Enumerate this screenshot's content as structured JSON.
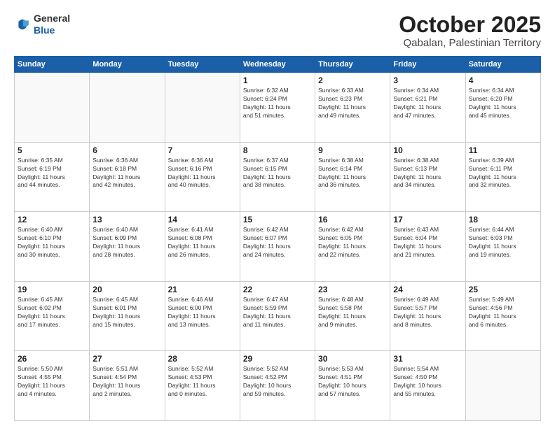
{
  "header": {
    "logo_general": "General",
    "logo_blue": "Blue",
    "month": "October 2025",
    "location": "Qabalan, Palestinian Territory"
  },
  "days_of_week": [
    "Sunday",
    "Monday",
    "Tuesday",
    "Wednesday",
    "Thursday",
    "Friday",
    "Saturday"
  ],
  "weeks": [
    [
      {
        "day": "",
        "info": ""
      },
      {
        "day": "",
        "info": ""
      },
      {
        "day": "",
        "info": ""
      },
      {
        "day": "1",
        "info": "Sunrise: 6:32 AM\nSunset: 6:24 PM\nDaylight: 11 hours\nand 51 minutes."
      },
      {
        "day": "2",
        "info": "Sunrise: 6:33 AM\nSunset: 6:23 PM\nDaylight: 11 hours\nand 49 minutes."
      },
      {
        "day": "3",
        "info": "Sunrise: 6:34 AM\nSunset: 6:21 PM\nDaylight: 11 hours\nand 47 minutes."
      },
      {
        "day": "4",
        "info": "Sunrise: 6:34 AM\nSunset: 6:20 PM\nDaylight: 11 hours\nand 45 minutes."
      }
    ],
    [
      {
        "day": "5",
        "info": "Sunrise: 6:35 AM\nSunset: 6:19 PM\nDaylight: 11 hours\nand 44 minutes."
      },
      {
        "day": "6",
        "info": "Sunrise: 6:36 AM\nSunset: 6:18 PM\nDaylight: 11 hours\nand 42 minutes."
      },
      {
        "day": "7",
        "info": "Sunrise: 6:36 AM\nSunset: 6:16 PM\nDaylight: 11 hours\nand 40 minutes."
      },
      {
        "day": "8",
        "info": "Sunrise: 6:37 AM\nSunset: 6:15 PM\nDaylight: 11 hours\nand 38 minutes."
      },
      {
        "day": "9",
        "info": "Sunrise: 6:38 AM\nSunset: 6:14 PM\nDaylight: 11 hours\nand 36 minutes."
      },
      {
        "day": "10",
        "info": "Sunrise: 6:38 AM\nSunset: 6:13 PM\nDaylight: 11 hours\nand 34 minutes."
      },
      {
        "day": "11",
        "info": "Sunrise: 6:39 AM\nSunset: 6:11 PM\nDaylight: 11 hours\nand 32 minutes."
      }
    ],
    [
      {
        "day": "12",
        "info": "Sunrise: 6:40 AM\nSunset: 6:10 PM\nDaylight: 11 hours\nand 30 minutes."
      },
      {
        "day": "13",
        "info": "Sunrise: 6:40 AM\nSunset: 6:09 PM\nDaylight: 11 hours\nand 28 minutes."
      },
      {
        "day": "14",
        "info": "Sunrise: 6:41 AM\nSunset: 6:08 PM\nDaylight: 11 hours\nand 26 minutes."
      },
      {
        "day": "15",
        "info": "Sunrise: 6:42 AM\nSunset: 6:07 PM\nDaylight: 11 hours\nand 24 minutes."
      },
      {
        "day": "16",
        "info": "Sunrise: 6:42 AM\nSunset: 6:05 PM\nDaylight: 11 hours\nand 22 minutes."
      },
      {
        "day": "17",
        "info": "Sunrise: 6:43 AM\nSunset: 6:04 PM\nDaylight: 11 hours\nand 21 minutes."
      },
      {
        "day": "18",
        "info": "Sunrise: 6:44 AM\nSunset: 6:03 PM\nDaylight: 11 hours\nand 19 minutes."
      }
    ],
    [
      {
        "day": "19",
        "info": "Sunrise: 6:45 AM\nSunset: 6:02 PM\nDaylight: 11 hours\nand 17 minutes."
      },
      {
        "day": "20",
        "info": "Sunrise: 6:45 AM\nSunset: 6:01 PM\nDaylight: 11 hours\nand 15 minutes."
      },
      {
        "day": "21",
        "info": "Sunrise: 6:46 AM\nSunset: 6:00 PM\nDaylight: 11 hours\nand 13 minutes."
      },
      {
        "day": "22",
        "info": "Sunrise: 6:47 AM\nSunset: 5:59 PM\nDaylight: 11 hours\nand 11 minutes."
      },
      {
        "day": "23",
        "info": "Sunrise: 6:48 AM\nSunset: 5:58 PM\nDaylight: 11 hours\nand 9 minutes."
      },
      {
        "day": "24",
        "info": "Sunrise: 6:49 AM\nSunset: 5:57 PM\nDaylight: 11 hours\nand 8 minutes."
      },
      {
        "day": "25",
        "info": "Sunrise: 5:49 AM\nSunset: 4:56 PM\nDaylight: 11 hours\nand 6 minutes."
      }
    ],
    [
      {
        "day": "26",
        "info": "Sunrise: 5:50 AM\nSunset: 4:55 PM\nDaylight: 11 hours\nand 4 minutes."
      },
      {
        "day": "27",
        "info": "Sunrise: 5:51 AM\nSunset: 4:54 PM\nDaylight: 11 hours\nand 2 minutes."
      },
      {
        "day": "28",
        "info": "Sunrise: 5:52 AM\nSunset: 4:53 PM\nDaylight: 11 hours\nand 0 minutes."
      },
      {
        "day": "29",
        "info": "Sunrise: 5:52 AM\nSunset: 4:52 PM\nDaylight: 10 hours\nand 59 minutes."
      },
      {
        "day": "30",
        "info": "Sunrise: 5:53 AM\nSunset: 4:51 PM\nDaylight: 10 hours\nand 57 minutes."
      },
      {
        "day": "31",
        "info": "Sunrise: 5:54 AM\nSunset: 4:50 PM\nDaylight: 10 hours\nand 55 minutes."
      },
      {
        "day": "",
        "info": ""
      }
    ]
  ]
}
